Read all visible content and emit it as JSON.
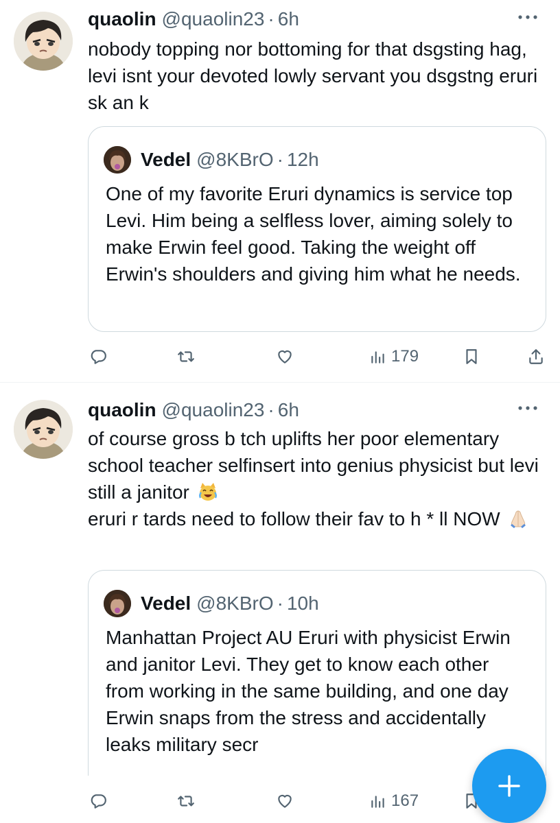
{
  "tweets": [
    {
      "author": {
        "name": "quaolin",
        "handle": "@quaolin23",
        "time": "6h"
      },
      "text": "nobody topping nor bottoming for that dsgsting hag, levi isnt your devoted lowly servant you dsgstng eruri sk an k",
      "quote": {
        "author": {
          "name": "Vedel",
          "handle": "@8KBrO",
          "time": "12h"
        },
        "text": "One of my favorite Eruri dynamics is service top Levi. Him being a selfless lover, aiming solely to make Erwin feel good. Taking the weight off Erwin's shoulders and giving him what he needs."
      },
      "views": "179"
    },
    {
      "author": {
        "name": "quaolin",
        "handle": "@quaolin23",
        "time": "6h"
      },
      "text_line1": "of course gross b tch uplifts her poor elementary school teacher selfinsert into genius physicist but levi still a janitor",
      "text_line2": "eruri r tards need to follow their fav to h * ll NOW",
      "quote": {
        "author": {
          "name": "Vedel",
          "handle": "@8KBrO",
          "time": "10h"
        },
        "text": "Manhattan Project AU Eruri with physicist Erwin and janitor Levi. They get to know each other from working in the same building, and one day Erwin snaps from the stress and accidentally leaks military secr"
      },
      "views": "167"
    }
  ],
  "separator": "·",
  "icons": {
    "reply": "reply-icon",
    "retweet": "retweet-icon",
    "like": "heart-icon",
    "views": "views-icon",
    "bookmark": "bookmark-icon",
    "share": "share-icon",
    "more": "more-icon",
    "compose": "plus-icon"
  },
  "colors": {
    "accent": "#1d9bf0",
    "secondary_text": "#536471",
    "border": "#cfd9de"
  }
}
